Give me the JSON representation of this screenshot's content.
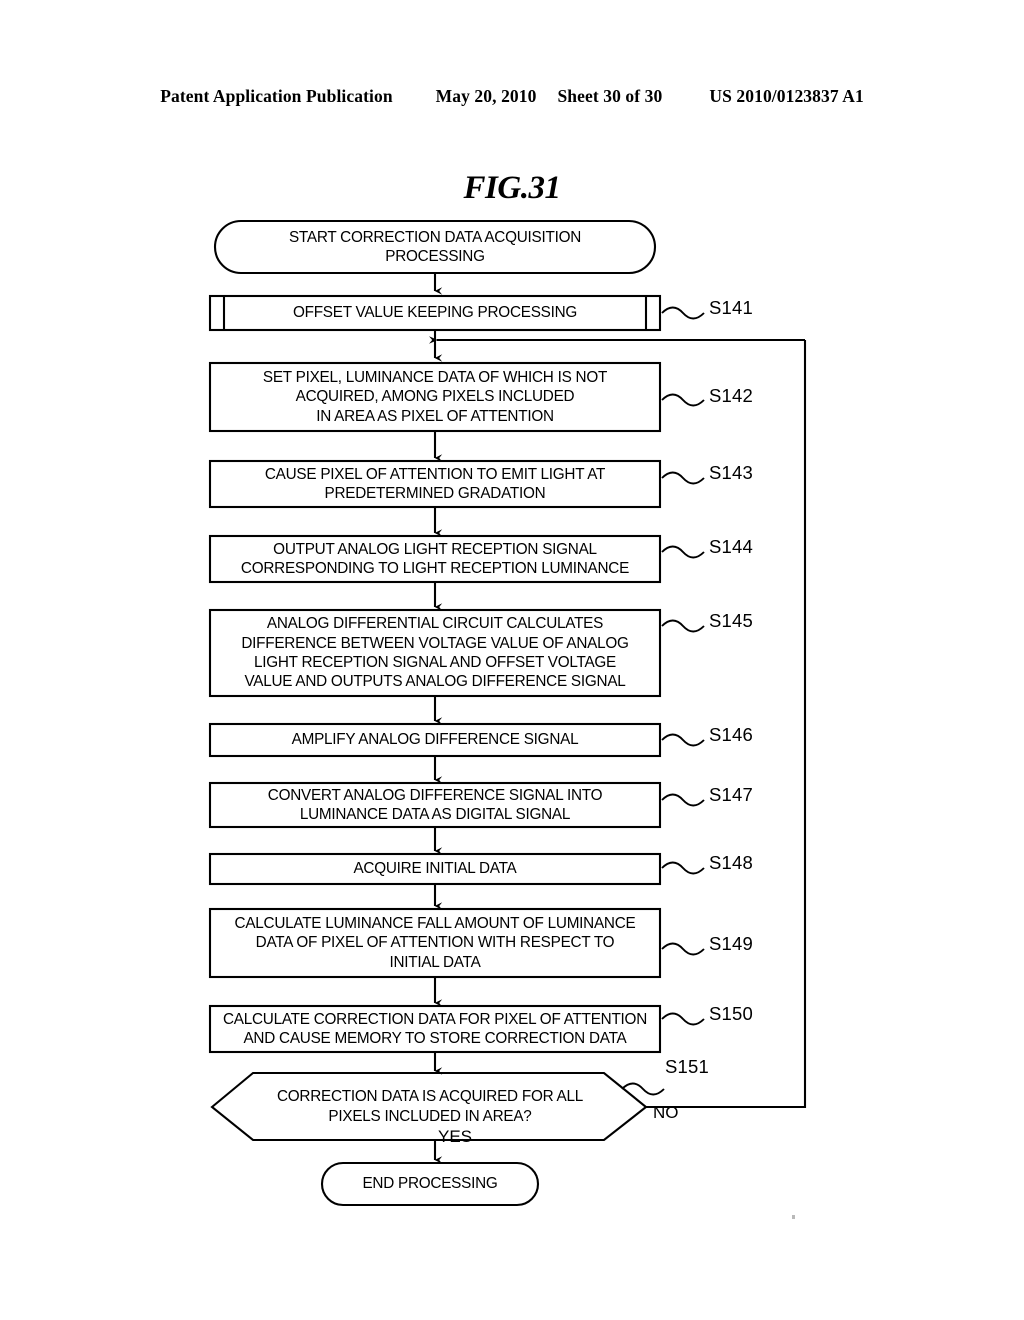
{
  "header": {
    "publication": "Patent Application Publication",
    "date": "May 20, 2010",
    "sheet": "Sheet 30 of 30",
    "patent_number": "US 2010/0123837 A1"
  },
  "figure": {
    "title": "FIG.31"
  },
  "flowchart": {
    "start": {
      "label": "START CORRECTION DATA ACQUISITION\nPROCESSING",
      "shape": "terminator"
    },
    "end": {
      "label": "END PROCESSING",
      "shape": "terminator"
    },
    "decision": {
      "label": "CORRECTION DATA IS ACQUIRED FOR ALL\nPIXELS INCLUDED IN AREA?",
      "step": "S151",
      "yes_label": "YES",
      "no_label": "NO",
      "shape": "hexagon"
    },
    "steps": [
      {
        "step": "S141",
        "label": "OFFSET VALUE KEEPING PROCESSING",
        "shape": "predefined-process"
      },
      {
        "step": "S142",
        "label": "SET PIXEL, LUMINANCE DATA OF WHICH IS NOT\nACQUIRED, AMONG PIXELS INCLUDED\nIN AREA AS PIXEL OF ATTENTION",
        "shape": "process"
      },
      {
        "step": "S143",
        "label": "CAUSE PIXEL OF ATTENTION TO EMIT LIGHT AT\nPREDETERMINED GRADATION",
        "shape": "process"
      },
      {
        "step": "S144",
        "label": "OUTPUT ANALOG LIGHT RECEPTION SIGNAL\nCORRESPONDING TO LIGHT RECEPTION LUMINANCE",
        "shape": "process"
      },
      {
        "step": "S145",
        "label": "ANALOG DIFFERENTIAL CIRCUIT CALCULATES\nDIFFERENCE BETWEEN VOLTAGE VALUE OF ANALOG\nLIGHT RECEPTION SIGNAL AND OFFSET VOLTAGE\nVALUE AND OUTPUTS ANALOG DIFFERENCE SIGNAL",
        "shape": "process"
      },
      {
        "step": "S146",
        "label": "AMPLIFY ANALOG DIFFERENCE SIGNAL",
        "shape": "process"
      },
      {
        "step": "S147",
        "label": "CONVERT ANALOG DIFFERENCE SIGNAL INTO\nLUMINANCE DATA AS DIGITAL SIGNAL",
        "shape": "process"
      },
      {
        "step": "S148",
        "label": "ACQUIRE INITIAL DATA",
        "shape": "process"
      },
      {
        "step": "S149",
        "label": "CALCULATE LUMINANCE FALL AMOUNT OF LUMINANCE\nDATA OF PIXEL OF ATTENTION WITH RESPECT TO\nINITIAL DATA",
        "shape": "process"
      },
      {
        "step": "S150",
        "label": "CALCULATE CORRECTION DATA FOR PIXEL OF ATTENTION\nAND CAUSE MEMORY TO STORE CORRECTION DATA",
        "shape": "process"
      }
    ]
  },
  "colors": {
    "ink": "#000000",
    "paper": "#ffffff"
  }
}
